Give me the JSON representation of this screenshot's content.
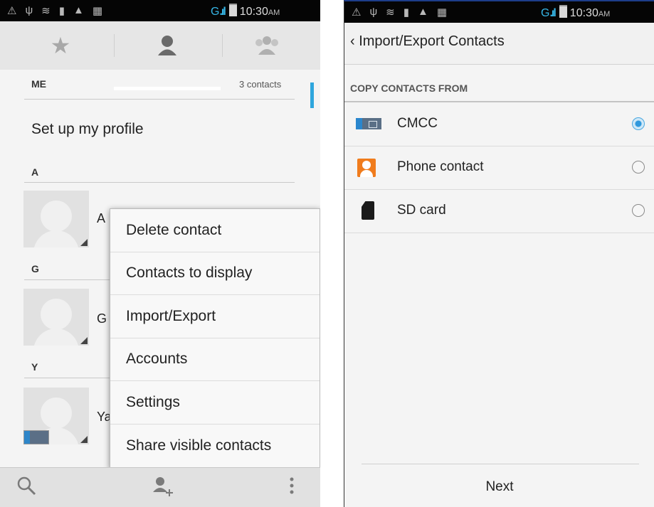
{
  "status_bar": {
    "icons": [
      "⚠",
      "ψ",
      "≋",
      "▮",
      "▲",
      "▦"
    ],
    "network": "G",
    "time": "10:30",
    "ampm": "AM"
  },
  "left": {
    "tabs": [
      "favorites-tab",
      "contacts-tab",
      "groups-tab"
    ],
    "me_header": "ME",
    "contacts_count": "3 contacts",
    "profile_text": "Set up my profile",
    "sections": [
      {
        "letter": "A",
        "name": "A"
      },
      {
        "letter": "G",
        "name": "G"
      },
      {
        "letter": "Y",
        "name": "Ya"
      }
    ],
    "menu": [
      "Delete contact",
      "Contacts to display",
      "Import/Export",
      "Accounts",
      "Settings",
      "Share visible contacts"
    ],
    "bottom": {
      "search": "search-icon",
      "add": "add-contact-icon",
      "more": "overflow-icon"
    }
  },
  "right": {
    "title": "‹ Import/Export Contacts",
    "section_header": "COPY CONTACTS FROM",
    "options": [
      {
        "label": "CMCC",
        "selected": true
      },
      {
        "label": "Phone contact",
        "selected": false
      },
      {
        "label": "SD card",
        "selected": false
      }
    ],
    "next_label": "Next"
  },
  "colors": {
    "accent": "#2fa6dd",
    "status_bar": "#050505",
    "phone_icon": "#f07c1d"
  }
}
